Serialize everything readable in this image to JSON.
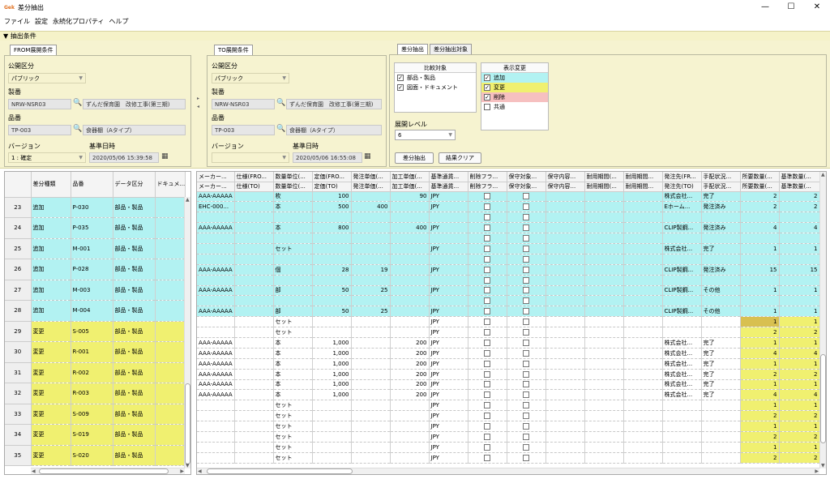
{
  "window": {
    "title": "差分抽出",
    "app_icon": "Gek",
    "min": "—",
    "max": "☐",
    "close": "✕"
  },
  "menu": [
    "ファイル",
    "設定",
    "永続化プロパティ",
    "ヘルプ"
  ],
  "conditions": {
    "header": "▼ 抽出条件"
  },
  "from": {
    "tab": "FROM展開条件",
    "pub_label": "公開区分",
    "pub_value": "パブリック",
    "seiban_label": "製番",
    "seiban_value": "NRW-NSR03",
    "seiban_name": "ずんだ保育園　改修工事(第三期)",
    "hinban_label": "品番",
    "hinban_value": "TP-003",
    "hinban_name": "食器棚（Aタイプ）",
    "version_label": "バージョン",
    "version_value": "1 : 確定",
    "date_label": "基準日時",
    "date_value": "2020/05/06 15:39:58"
  },
  "to": {
    "tab": "TO展開条件",
    "pub_label": "公開区分",
    "pub_value": "パブリック",
    "seiban_label": "製番",
    "seiban_value": "NRW-NSR03",
    "seiban_name": "ずんだ保育園　改修工事(第三期)",
    "hinban_label": "品番",
    "hinban_value": "TP-003",
    "hinban_name": "食器棚（Aタイプ）",
    "version_label": "バージョン",
    "version_value": "",
    "date_label": "基準日時",
    "date_value": "2020/05/06 16:55:08"
  },
  "diff": {
    "tab1": "差分抽出",
    "tab2": "差分抽出対象",
    "compare_title": "比較対象",
    "compare": [
      {
        "label": "部品・製品",
        "checked": true
      },
      {
        "label": "図面・ドキュメント",
        "checked": true
      }
    ],
    "display_title": "表示変更",
    "display": [
      {
        "label": "追加",
        "checked": true,
        "color": "#b2f2f2"
      },
      {
        "label": "変更",
        "checked": true,
        "color": "#f0f070"
      },
      {
        "label": "削除",
        "checked": true,
        "color": "#f6c0c0"
      },
      {
        "label": "共通",
        "checked": false,
        "color": "#ffffff"
      }
    ],
    "level_label": "展開レベル",
    "level_value": "6",
    "extract_btn": "差分抽出",
    "clear_btn": "結果クリア"
  },
  "left_grid": {
    "headers": [
      "差分種類",
      "品番",
      "データ区分",
      "ドキュメ..."
    ],
    "rows": [
      {
        "n": "23",
        "type": "追加",
        "part": "P-030",
        "kind": "部品・製品",
        "t": "add"
      },
      {
        "n": "24",
        "type": "追加",
        "part": "P-035",
        "kind": "部品・製品",
        "t": "add"
      },
      {
        "n": "25",
        "type": "追加",
        "part": "M-001",
        "kind": "部品・製品",
        "t": "add"
      },
      {
        "n": "26",
        "type": "追加",
        "part": "P-028",
        "kind": "部品・製品",
        "t": "add"
      },
      {
        "n": "27",
        "type": "追加",
        "part": "M-003",
        "kind": "部品・製品",
        "t": "add"
      },
      {
        "n": "28",
        "type": "追加",
        "part": "M-004",
        "kind": "部品・製品",
        "t": "add"
      },
      {
        "n": "29",
        "type": "変更",
        "part": "S-005",
        "kind": "部品・製品",
        "t": "chg"
      },
      {
        "n": "30",
        "type": "変更",
        "part": "R-001",
        "kind": "部品・製品",
        "t": "chg"
      },
      {
        "n": "31",
        "type": "変更",
        "part": "R-002",
        "kind": "部品・製品",
        "t": "chg"
      },
      {
        "n": "32",
        "type": "変更",
        "part": "R-003",
        "kind": "部品・製品",
        "t": "chg"
      },
      {
        "n": "33",
        "type": "変更",
        "part": "S-009",
        "kind": "部品・製品",
        "t": "chg"
      },
      {
        "n": "34",
        "type": "変更",
        "part": "S-019",
        "kind": "部品・製品",
        "t": "chg"
      },
      {
        "n": "35",
        "type": "変更",
        "part": "S-020",
        "kind": "部品・製品",
        "t": "chg"
      }
    ]
  },
  "right_grid": {
    "headers1": [
      "メーカー...",
      "仕様(FRO...",
      "数量単位(...",
      "定価(FRO...",
      "発注単価(...",
      "加工単価(...",
      "基準通貨...",
      "削除フラ...",
      "保守対象...",
      "保守内容...",
      "耐用期間(...",
      "耐用期間...",
      "発注先(FR...",
      "手配状況...",
      "所要数量(...",
      "基準数量(..."
    ],
    "headers2": [
      "メーカー...",
      "仕様(TO)",
      "数量単位(...",
      "定価(TO)",
      "発注単価(...",
      "加工単価(...",
      "基準通貨...",
      "削除フラ...",
      "保守対象...",
      "保守内容...",
      "耐用期間(...",
      "耐用期間...",
      "発注先(TO)",
      "手配状況...",
      "所要数量(...",
      "基準数量(..."
    ],
    "rows": [
      {
        "t": "add",
        "c": [
          "AAA-AAAAA",
          "",
          "枚",
          "100",
          "",
          "90",
          "JPY",
          "□",
          "□",
          "",
          "",
          "",
          "株式会社...",
          "完了",
          "2",
          "2"
        ]
      },
      {
        "t": "add",
        "c": [
          "EHC-000...",
          "",
          "本",
          "500",
          "400",
          "",
          "JPY",
          "□",
          "□",
          "",
          "",
          "",
          "Eホーム...",
          "発注済み",
          "2",
          "2"
        ]
      },
      {
        "t": "add",
        "c": [
          "",
          "",
          "",
          "",
          "",
          "",
          "",
          "□",
          "□",
          "",
          "",
          "",
          "",
          "",
          "",
          ""
        ]
      },
      {
        "t": "add",
        "c": [
          "AAA-AAAAA",
          "",
          "本",
          "800",
          "",
          "400",
          "JPY",
          "□",
          "□",
          "",
          "",
          "",
          "CLIP製鋼...",
          "発注済み",
          "4",
          "4"
        ]
      },
      {
        "t": "add",
        "c": [
          "",
          "",
          "",
          "",
          "",
          "",
          "",
          "□",
          "□",
          "",
          "",
          "",
          "",
          "",
          "",
          ""
        ]
      },
      {
        "t": "add",
        "c": [
          "",
          "",
          "セット",
          "",
          "",
          "",
          "JPY",
          "□",
          "□",
          "",
          "",
          "",
          "株式会社...",
          "完了",
          "1",
          "1"
        ]
      },
      {
        "t": "add",
        "c": [
          "",
          "",
          "",
          "",
          "",
          "",
          "",
          "□",
          "□",
          "",
          "",
          "",
          "",
          "",
          "",
          ""
        ]
      },
      {
        "t": "add",
        "c": [
          "AAA-AAAAA",
          "",
          "個",
          "28",
          "19",
          "",
          "JPY",
          "□",
          "□",
          "",
          "",
          "",
          "CLIP製鋼...",
          "発注済み",
          "15",
          "15"
        ]
      },
      {
        "t": "add",
        "c": [
          "",
          "",
          "",
          "",
          "",
          "",
          "",
          "□",
          "□",
          "",
          "",
          "",
          "",
          "",
          "",
          ""
        ]
      },
      {
        "t": "add",
        "c": [
          "AAA-AAAAA",
          "",
          "部",
          "50",
          "25",
          "",
          "JPY",
          "□",
          "□",
          "",
          "",
          "",
          "CLIP製鋼...",
          "その他",
          "1",
          "1"
        ]
      },
      {
        "t": "add",
        "c": [
          "",
          "",
          "",
          "",
          "",
          "",
          "",
          "□",
          "□",
          "",
          "",
          "",
          "",
          "",
          "",
          ""
        ]
      },
      {
        "t": "add",
        "c": [
          "AAA-AAAAA",
          "",
          "部",
          "50",
          "25",
          "",
          "JPY",
          "□",
          "□",
          "",
          "",
          "",
          "CLIP製鋼...",
          "その他",
          "1",
          "1"
        ]
      },
      {
        "t": "chg",
        "c": [
          "",
          "",
          "セット",
          "",
          "",
          "",
          "JPY",
          "□",
          "□",
          "",
          "",
          "",
          "",
          "",
          "1",
          "1"
        ],
        "hl": "dark"
      },
      {
        "t": "chg",
        "c": [
          "",
          "",
          "セット",
          "",
          "",
          "",
          "JPY",
          "□",
          "□",
          "",
          "",
          "",
          "",
          "",
          "2",
          "2"
        ]
      },
      {
        "t": "chg",
        "c": [
          "AAA-AAAAA",
          "",
          "本",
          "1,000",
          "",
          "200",
          "JPY",
          "□",
          "□",
          "",
          "",
          "",
          "株式会社...",
          "完了",
          "1",
          "1"
        ]
      },
      {
        "t": "chg",
        "c": [
          "AAA-AAAAA",
          "",
          "本",
          "1,000",
          "",
          "200",
          "JPY",
          "□",
          "□",
          "",
          "",
          "",
          "株式会社...",
          "完了",
          "4",
          "4"
        ]
      },
      {
        "t": "chg",
        "c": [
          "AAA-AAAAA",
          "",
          "本",
          "1,000",
          "",
          "200",
          "JPY",
          "□",
          "□",
          "",
          "",
          "",
          "株式会社...",
          "完了",
          "1",
          "1"
        ]
      },
      {
        "t": "chg",
        "c": [
          "AAA-AAAAA",
          "",
          "本",
          "1,000",
          "",
          "200",
          "JPY",
          "□",
          "□",
          "",
          "",
          "",
          "株式会社...",
          "完了",
          "2",
          "2"
        ]
      },
      {
        "t": "chg",
        "c": [
          "AAA-AAAAA",
          "",
          "本",
          "1,000",
          "",
          "200",
          "JPY",
          "□",
          "□",
          "",
          "",
          "",
          "株式会社...",
          "完了",
          "1",
          "1"
        ]
      },
      {
        "t": "chg",
        "c": [
          "AAA-AAAAA",
          "",
          "本",
          "1,000",
          "",
          "200",
          "JPY",
          "□",
          "□",
          "",
          "",
          "",
          "株式会社...",
          "完了",
          "4",
          "4"
        ]
      },
      {
        "t": "chg",
        "c": [
          "",
          "",
          "セット",
          "",
          "",
          "",
          "JPY",
          "□",
          "□",
          "",
          "",
          "",
          "",
          "",
          "1",
          "1"
        ]
      },
      {
        "t": "chg",
        "c": [
          "",
          "",
          "セット",
          "",
          "",
          "",
          "JPY",
          "□",
          "□",
          "",
          "",
          "",
          "",
          "",
          "2",
          "2"
        ]
      },
      {
        "t": "chg",
        "c": [
          "",
          "",
          "セット",
          "",
          "",
          "",
          "JPY",
          "□",
          "□",
          "",
          "",
          "",
          "",
          "",
          "1",
          "1"
        ]
      },
      {
        "t": "chg",
        "c": [
          "",
          "",
          "セット",
          "",
          "",
          "",
          "JPY",
          "□",
          "□",
          "",
          "",
          "",
          "",
          "",
          "2",
          "2"
        ]
      },
      {
        "t": "chg",
        "c": [
          "",
          "",
          "セット",
          "",
          "",
          "",
          "JPY",
          "□",
          "□",
          "",
          "",
          "",
          "",
          "",
          "1",
          "1"
        ]
      },
      {
        "t": "chg",
        "c": [
          "",
          "",
          "セット",
          "",
          "",
          "",
          "JPY",
          "□",
          "□",
          "",
          "",
          "",
          "",
          "",
          "2",
          "2"
        ]
      }
    ]
  }
}
